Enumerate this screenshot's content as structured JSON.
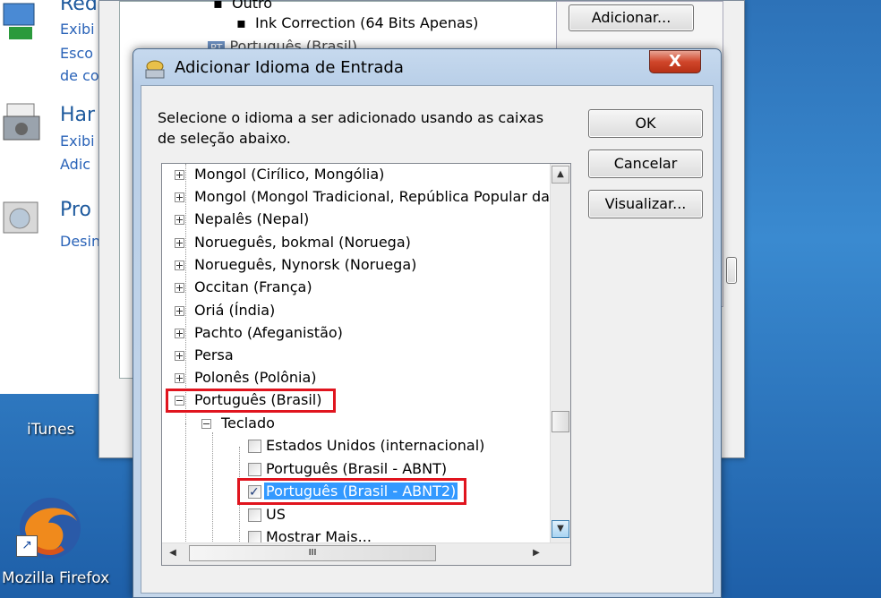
{
  "control_panel": {
    "sections": [
      {
        "head": "Red",
        "lines": [
          "Exibi",
          "Esco",
          "de co"
        ]
      },
      {
        "head": "Har",
        "lines": [
          "Exibi",
          "Adic"
        ]
      },
      {
        "head": "Pro",
        "lines": [
          "Desin"
        ]
      }
    ]
  },
  "background_dialog": {
    "tree": {
      "item1": "Outro",
      "item2": "Ink Correction (64 Bits Apenas)",
      "item3_badge": "PT",
      "item3": "Português (Brasil)"
    },
    "add_button": "Adicionar..."
  },
  "desktop": {
    "icons": [
      {
        "label": "iTunes"
      },
      {
        "label": "Mozilla Firefox"
      }
    ]
  },
  "dialog": {
    "title": "Adicionar Idioma de Entrada",
    "close_label": "X",
    "instruction": "Selecione o idioma a ser adicionado usando as caixas de seleção abaixo.",
    "buttons": {
      "ok": "OK",
      "cancel": "Cancelar",
      "preview": "Visualizar..."
    },
    "tree": {
      "languages": [
        "Mongol (Cirílico, Mongólia)",
        "Mongol (Mongol Tradicional, República Popular da C",
        "Nepalês (Nepal)",
        "Norueguês, bokmal (Noruega)",
        "Norueguês, Nynorsk (Noruega)",
        "Occitan (França)",
        "Oriá (Índia)",
        "Pachto (Afeganistão)",
        "Persa",
        "Polonês (Polônia)"
      ],
      "expanded_language": "Português (Brasil)",
      "keyboard_group": "Teclado",
      "keyboards": [
        {
          "label": "Estados Unidos (internacional)",
          "checked": false
        },
        {
          "label": "Português (Brasil - ABNT)",
          "checked": false
        },
        {
          "label": "Português (Brasil - ABNT2)",
          "checked": true
        },
        {
          "label": "US",
          "checked": false
        },
        {
          "label": "Mostrar Mais...",
          "checked": false
        }
      ]
    },
    "scroll": {
      "up": "▲",
      "down": "▼",
      "left": "◀",
      "right": "▶",
      "grip": "III"
    }
  },
  "colors": {
    "highlight_box": "#e0141e",
    "selection": "#3399ff"
  }
}
